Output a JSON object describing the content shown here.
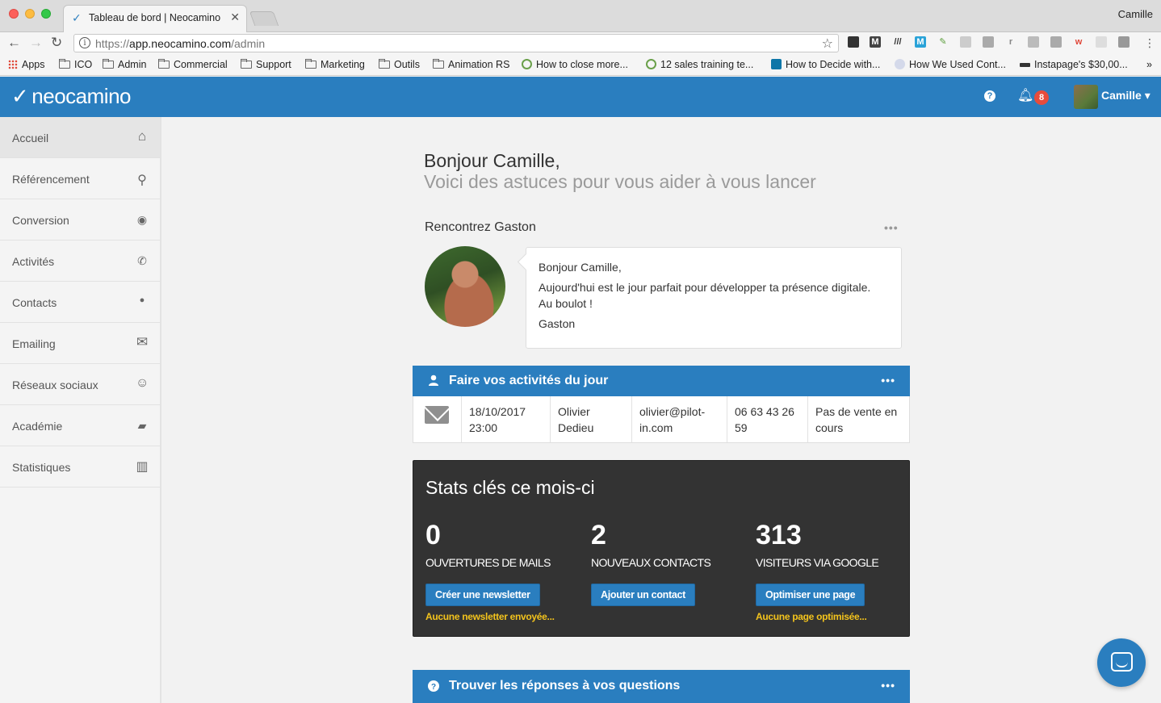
{
  "browser": {
    "tab_title": "Tableau de bord | Neocamino",
    "tab_close": "✕",
    "profile_name": "Camille",
    "url_prefix": "https://",
    "url_host": "app.neocamino.com",
    "url_path": "/admin",
    "bookmarks": [
      {
        "label": "Apps",
        "kind": "apps"
      },
      {
        "label": "ICO",
        "kind": "folder"
      },
      {
        "label": "Admin",
        "kind": "folder"
      },
      {
        "label": "Commercial",
        "kind": "folder"
      },
      {
        "label": "Support",
        "kind": "folder"
      },
      {
        "label": "Marketing",
        "kind": "folder"
      },
      {
        "label": "Outils",
        "kind": "folder"
      },
      {
        "label": "Animation RS",
        "kind": "folder"
      },
      {
        "label": "How to close more...",
        "kind": "site"
      },
      {
        "label": "12 sales training te...",
        "kind": "site"
      },
      {
        "label": "How to Decide with...",
        "kind": "linkedin"
      },
      {
        "label": "How We Used Cont...",
        "kind": "site"
      },
      {
        "label": "Instapage's $30,00...",
        "kind": "site"
      }
    ],
    "bookmarks_more": "»"
  },
  "header": {
    "logo_text": "neocamino",
    "help_icon": "?",
    "notification_count": "8",
    "user_name": "Camille",
    "user_caret": "▾"
  },
  "sidebar": {
    "items": [
      {
        "label": "Accueil",
        "icon": "home-icon",
        "glyph": "⌂"
      },
      {
        "label": "Référencement",
        "icon": "search-icon",
        "glyph": "⚲"
      },
      {
        "label": "Conversion",
        "icon": "target-icon",
        "glyph": "◉"
      },
      {
        "label": "Activités",
        "icon": "phone-icon",
        "glyph": "✆"
      },
      {
        "label": "Contacts",
        "icon": "user-icon",
        "glyph": "●"
      },
      {
        "label": "Emailing",
        "icon": "envelope-icon",
        "glyph": "✉"
      },
      {
        "label": "Réseaux sociaux",
        "icon": "smiley-icon",
        "glyph": "☺"
      },
      {
        "label": "Académie",
        "icon": "book-icon",
        "glyph": "▰"
      },
      {
        "label": "Statistiques",
        "icon": "bar-chart-icon",
        "glyph": "▥"
      }
    ]
  },
  "main": {
    "greeting": "Bonjour Camille,",
    "subgreeting": "Voici des astuces pour vous aider à vous lancer",
    "meet": {
      "title": "Rencontrez Gaston",
      "menu": "•••",
      "lines": [
        "Bonjour Camille,",
        "Aujourd'hui est le jour parfait pour développer ta présence digitale.",
        "Au boulot !",
        "Gaston"
      ]
    },
    "activities": {
      "title": "Faire vos activités du jour",
      "menu": "•••",
      "row": {
        "datetime": "18/10/2017 23:00",
        "name": "Olivier Dedieu",
        "email": "olivier@pilot-in.com",
        "phone": "06 63 43 26 59",
        "status": "Pas de vente en cours"
      }
    },
    "stats": {
      "title": "Stats clés ce mois-ci",
      "items": [
        {
          "value": "0",
          "label": "OUVERTURES DE MAILS",
          "button": "Créer une newsletter",
          "note": "Aucune newsletter envoyée..."
        },
        {
          "value": "2",
          "label": "NOUVEAUX CONTACTS",
          "button": "Ajouter un contact",
          "note": ""
        },
        {
          "value": "313",
          "label": "VISITEURS VIA GOOGLE",
          "button": "Optimiser une page",
          "note": "Aucune page optimisée..."
        }
      ]
    },
    "faq": {
      "title": "Trouver les réponses à vos questions",
      "menu": "•••"
    }
  },
  "colors": {
    "brand_blue": "#2a7ebf",
    "stats_bg": "#333333",
    "warning_yellow": "#f3c31c",
    "badge_red": "#e74c3c"
  }
}
